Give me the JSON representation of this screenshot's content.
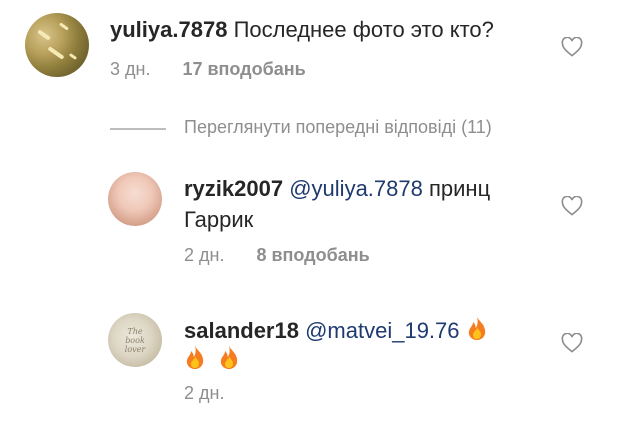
{
  "comments": [
    {
      "username": "yuliya.7878",
      "text": "Последнее фото это кто?",
      "time": "3 дн.",
      "likes": "17 вподобань",
      "avatar_icon": "user-avatar-photo"
    },
    {
      "username": "ryzik2007",
      "mention": "@yuliya.7878",
      "text_line1": "принц",
      "text_line2": "Гаррик",
      "time": "2 дн.",
      "likes": "8 вподобань",
      "avatar_icon": "user-avatar-photo"
    },
    {
      "username": "salander18",
      "mention": "@matvei_19.76",
      "time": "2 дн.",
      "emoji": "fire",
      "avatar_icon": "user-avatar-photo",
      "avatar_text": "The\nbook\nlover"
    }
  ],
  "replies": {
    "view_previous": "Переглянути попередні відповіді (11)"
  },
  "icons": {
    "like": "heart-outline-icon",
    "fire": "fire-emoji"
  },
  "colors": {
    "text": "#262626",
    "secondary": "#8e8e8e",
    "mention": "#1e3a6e"
  }
}
